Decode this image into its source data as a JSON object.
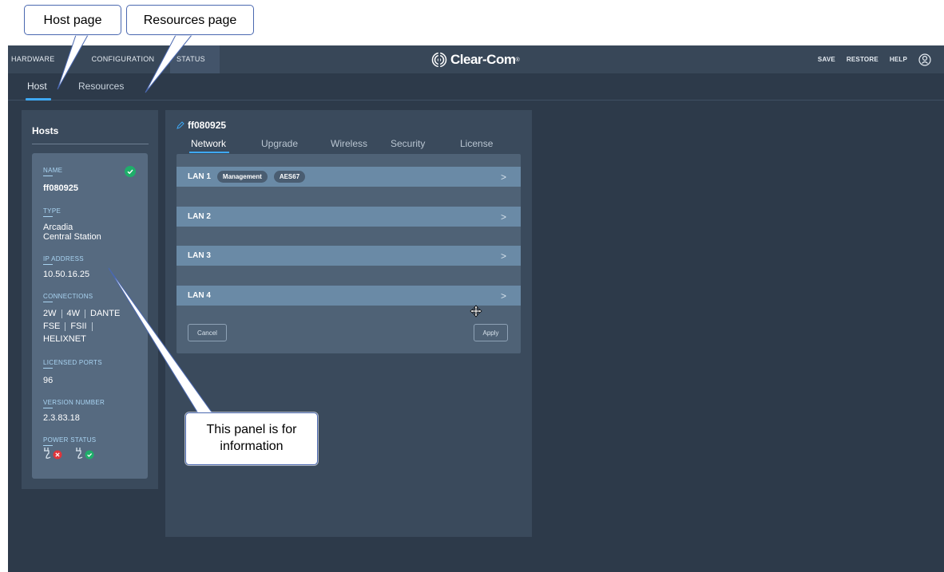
{
  "topbar": {
    "nav": [
      "HARDWARE",
      "CONFIGURATION",
      "STATUS"
    ],
    "brand": "Clear-Com",
    "brand_mark": "®",
    "actions": [
      "SAVE",
      "RESTORE",
      "HELP"
    ]
  },
  "subtabs": {
    "host": "Host",
    "resources": "Resources"
  },
  "hosts_panel": {
    "title": "Hosts",
    "fields": {
      "name_label": "NAME",
      "name_value": "ff080925",
      "type_label": "TYPE",
      "type_value_line1": "Arcadia",
      "type_value_line2": "Central Station",
      "ip_label": "IP ADDRESS",
      "ip_value": "10.50.16.25",
      "connections_label": "CONNECTIONS",
      "connections_row1": [
        "2W",
        "4W",
        "DANTE"
      ],
      "connections_row2": [
        "FSE",
        "FSII"
      ],
      "connections_row3": "HELIXNET",
      "licensed_label": "LICENSED PORTS",
      "licensed_value": "96",
      "version_label": "VERSION NUMBER",
      "version_value": "2.3.83.18",
      "power_label": "POWER STATUS"
    },
    "status_colors": {
      "ok": "#1fae6a",
      "error": "#e0353b"
    }
  },
  "main_panel": {
    "host_name": "ff080925",
    "tabs": [
      "Network",
      "Upgrade",
      "Wireless",
      "Security",
      "License"
    ],
    "active_tab": "Network",
    "lans": [
      {
        "label": "LAN 1",
        "tags": [
          "Management",
          "AES67"
        ]
      },
      {
        "label": "LAN 2",
        "tags": []
      },
      {
        "label": "LAN 3",
        "tags": []
      },
      {
        "label": "LAN 4",
        "tags": []
      }
    ],
    "chevron": ">",
    "cancel_label": "Cancel",
    "apply_label": "Apply"
  },
  "callouts": {
    "host_page": "Host page",
    "resources_page": "Resources page",
    "info_line1": "This panel is for",
    "info_line2": "information"
  },
  "colors": {
    "accent": "#3fa9f5",
    "background": "#2d3a4a",
    "panel": "#3a4a5c",
    "lan_row": "#6a8aa6"
  }
}
